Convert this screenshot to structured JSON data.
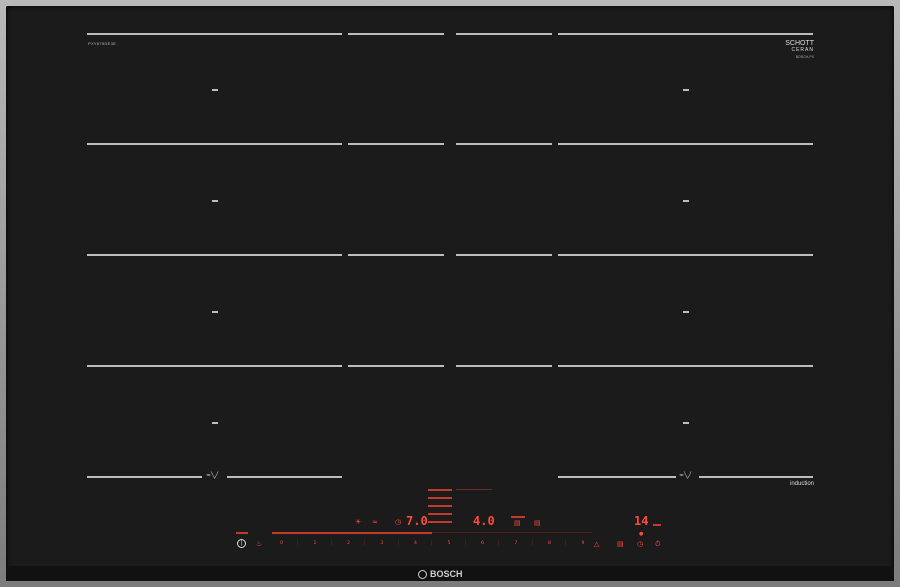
{
  "panel": {
    "model_tag": "PXY875DE3E",
    "schott_line1": "SCHOTT",
    "schott_line2": "CERAN",
    "schott_line3": "BOSCH-PX",
    "induction_label": "induction",
    "brand": "BOSCH"
  },
  "zones": {
    "left_flex_icon": "≈╲╱",
    "right_flex_icon": "≈╲╱"
  },
  "controls": {
    "power_icon": "power-icon",
    "scale_numbers": [
      "0",
      "1",
      "2",
      "3",
      "4",
      "5",
      "6",
      "7",
      "8",
      "9"
    ],
    "left_display": "7.0",
    "center_display": "4.0",
    "timer_display": "14",
    "accent_color": "#ff4a3a"
  }
}
